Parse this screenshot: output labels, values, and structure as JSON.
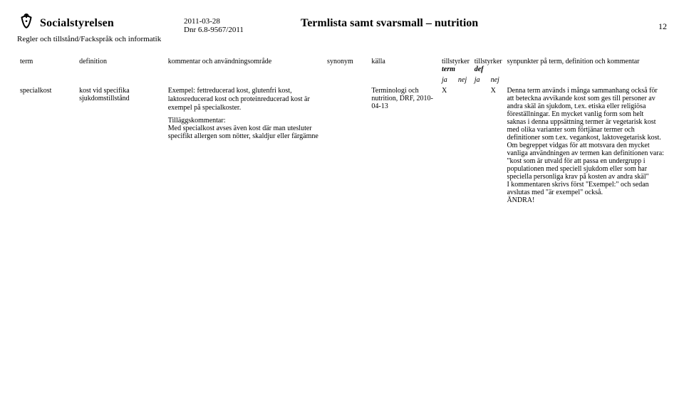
{
  "header": {
    "org_name": "Socialstyrelsen",
    "org_sub": "Regler och tillstånd/Fackspråk och informatik",
    "date": "2011-03-28",
    "dnr": "Dnr 6.8-9567/2011",
    "doc_title": "Termlista samt svarsmall – nutrition",
    "page_num": "12"
  },
  "columns": {
    "term": "term",
    "definition": "definition",
    "kommentar": "kommentar och användningsområde",
    "synonym": "synonym",
    "kalla": "källa",
    "tillstyrker_term": "tillstyrker",
    "tillstyrker_term_sub": "term",
    "tillstyrker_def": "tillstyrker",
    "tillstyrker_def_sub": "def",
    "ja": "ja",
    "nej": "nej",
    "synpunkter": "synpunkter på term, definition och kommentar"
  },
  "rows": [
    {
      "term": "specialkost",
      "definition": "kost vid specifika sjukdomstillstånd",
      "kommentar_p1": "Exempel: fettreducerad kost, glutenfri kost, laktosreducerad kost och proteinreducerad kost är exempel på specialkoster.",
      "kommentar_p2_label": "Tilläggskommentar:",
      "kommentar_p2": "Med specialkost avses även kost där man utesluter specifikt allergen som nötter, skaldjur eller färgämne",
      "synonym": "",
      "kalla": "Terminologi och nutrition, DRF, 2010-04-13",
      "term_ja": "X",
      "term_nej": "",
      "def_ja": "",
      "def_nej": "X",
      "synpunkter": "Denna term används i många sammanhang också för att beteckna avvikande kost som ges till personer av andra skäl än sjukdom, t.ex. etiska eller religiösa föreställningar. En mycket vanlig form som helt saknas i denna uppsättning termer är vegetarisk kost med olika varianter som förtjänar termer och definitioner som t.ex. vegankost, laktovegetarisk kost.\nOm begreppet vidgas för att motsvara den mycket vanliga användningen av termen kan definitionen vara:\n\"kost som är utvald för att passa en undergrupp i populationen med speciell sjukdom eller som har speciella personliga krav på kosten av andra skäl\"\nI kommentaren skrivs först \"Exempel:\" och sedan avslutas med \"är exempel\" också.\nÄNDRA!"
    }
  ]
}
